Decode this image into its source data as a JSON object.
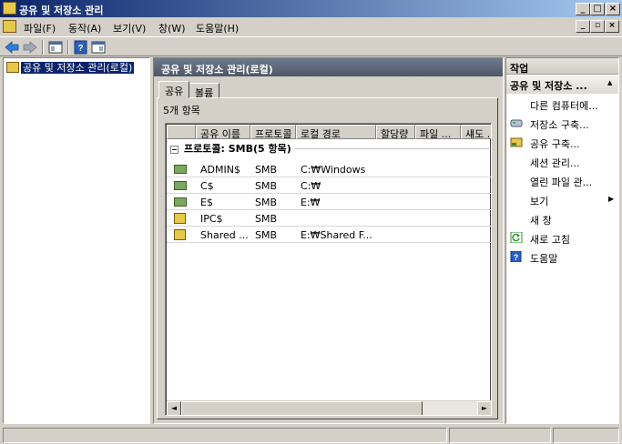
{
  "window": {
    "title": "공유 및 저장소 관리",
    "minimize": "_",
    "restore": "□",
    "close": "×"
  },
  "menu": {
    "items": [
      "파일(F)",
      "동작(A)",
      "보기(V)",
      "창(W)",
      "도움말(H)"
    ],
    "mdi_minimize": "_",
    "mdi_restore": "▫",
    "mdi_close": "×"
  },
  "toolbar": {
    "icons": [
      "back-arrow-icon",
      "forward-arrow-icon",
      "show-hide-console-tree-icon",
      "help-icon",
      "show-hide-action-pane-icon"
    ]
  },
  "tree": {
    "root_label": "공유 및 저장소 관리(로컬)"
  },
  "center": {
    "header": "공유 및 저장소 관리(로컬)",
    "tabs": [
      "공유",
      "볼륨"
    ],
    "active_tab": "공유",
    "item_count": "5개 항목",
    "columns": [
      "공유 이름",
      "프로토콜",
      "로컬 경로",
      "할당량",
      "파일 ...",
      "섀도 ..."
    ],
    "group_toggle": "−",
    "group_label": "프로토콜: SMB(5 항목)",
    "rows": [
      {
        "name": "ADMIN$",
        "protocol": "SMB",
        "path": "C:₩Windows",
        "icon": "share-icon"
      },
      {
        "name": "C$",
        "protocol": "SMB",
        "path": "C:₩",
        "icon": "share-icon"
      },
      {
        "name": "E$",
        "protocol": "SMB",
        "path": "E:₩",
        "icon": "share-icon"
      },
      {
        "name": "IPC$",
        "protocol": "SMB",
        "path": "",
        "icon": "ipc-share-icon"
      },
      {
        "name": "Shared ...",
        "protocol": "SMB",
        "path": "E:₩Shared F...",
        "icon": "shared-folder-icon"
      }
    ],
    "scroll_left": "◄",
    "scroll_right": "►"
  },
  "actions": {
    "header": "작업",
    "group_title": "공유 및 저장소 ...",
    "group_arrow": "▲",
    "items": [
      {
        "label": "다른 컴퓨터에...",
        "icon": ""
      },
      {
        "label": "저장소 구축...",
        "icon": "storage-drive-icon"
      },
      {
        "label": "공유 구축...",
        "icon": "share-folder-icon"
      },
      {
        "label": "세션 관리...",
        "icon": ""
      },
      {
        "label": "열린 파일 관...",
        "icon": ""
      },
      {
        "label": "보기",
        "icon": "",
        "submenu": "▶"
      },
      {
        "label": "새 창",
        "icon": ""
      },
      {
        "label": "새로 고침",
        "icon": "refresh-icon"
      },
      {
        "label": "도움말",
        "icon": "help-icon"
      }
    ]
  }
}
